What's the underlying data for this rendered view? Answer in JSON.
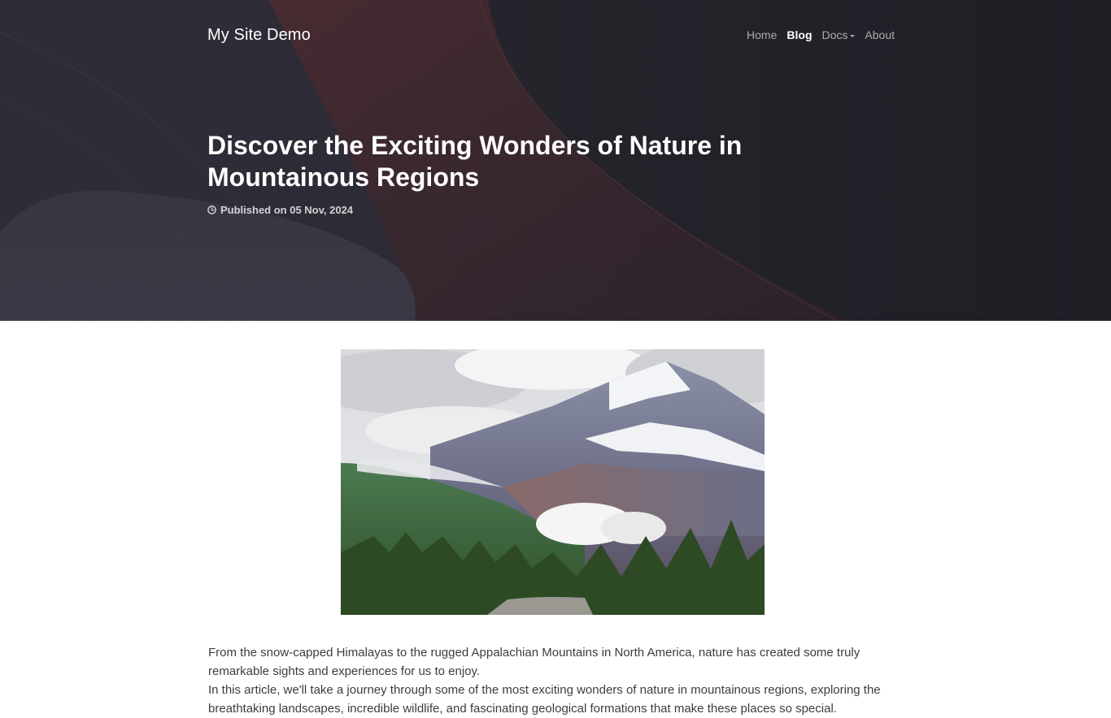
{
  "site": {
    "brand": "My Site Demo"
  },
  "nav": {
    "items": [
      {
        "label": "Home",
        "active": false
      },
      {
        "label": "Blog",
        "active": true
      },
      {
        "label": "Docs",
        "active": false,
        "dropdown": true
      },
      {
        "label": "About",
        "active": false
      }
    ]
  },
  "post": {
    "title": "Discover the Exciting Wonders of Nature in Mountainous Regions",
    "published": "Published on 05 Nov, 2024",
    "paragraphs": [
      "From the snow-capped Himalayas to the rugged Appalachian Mountains in North America, nature has created some truly remarkable sights and experiences for us to enjoy.",
      "In this article, we'll take a journey through some of the most exciting wonders of nature in mountainous regions, exploring the breathtaking landscapes, incredible wildlife, and fascinating geological formations that make these places so special."
    ]
  },
  "colors": {
    "hero_bg": "#23222b",
    "hero_accent": "#4a2a2f",
    "text": "#3d3d3d",
    "nav_inactive": "#a9a8ad",
    "nav_active": "#ffffff"
  },
  "icons": {
    "published": "clock-icon"
  }
}
